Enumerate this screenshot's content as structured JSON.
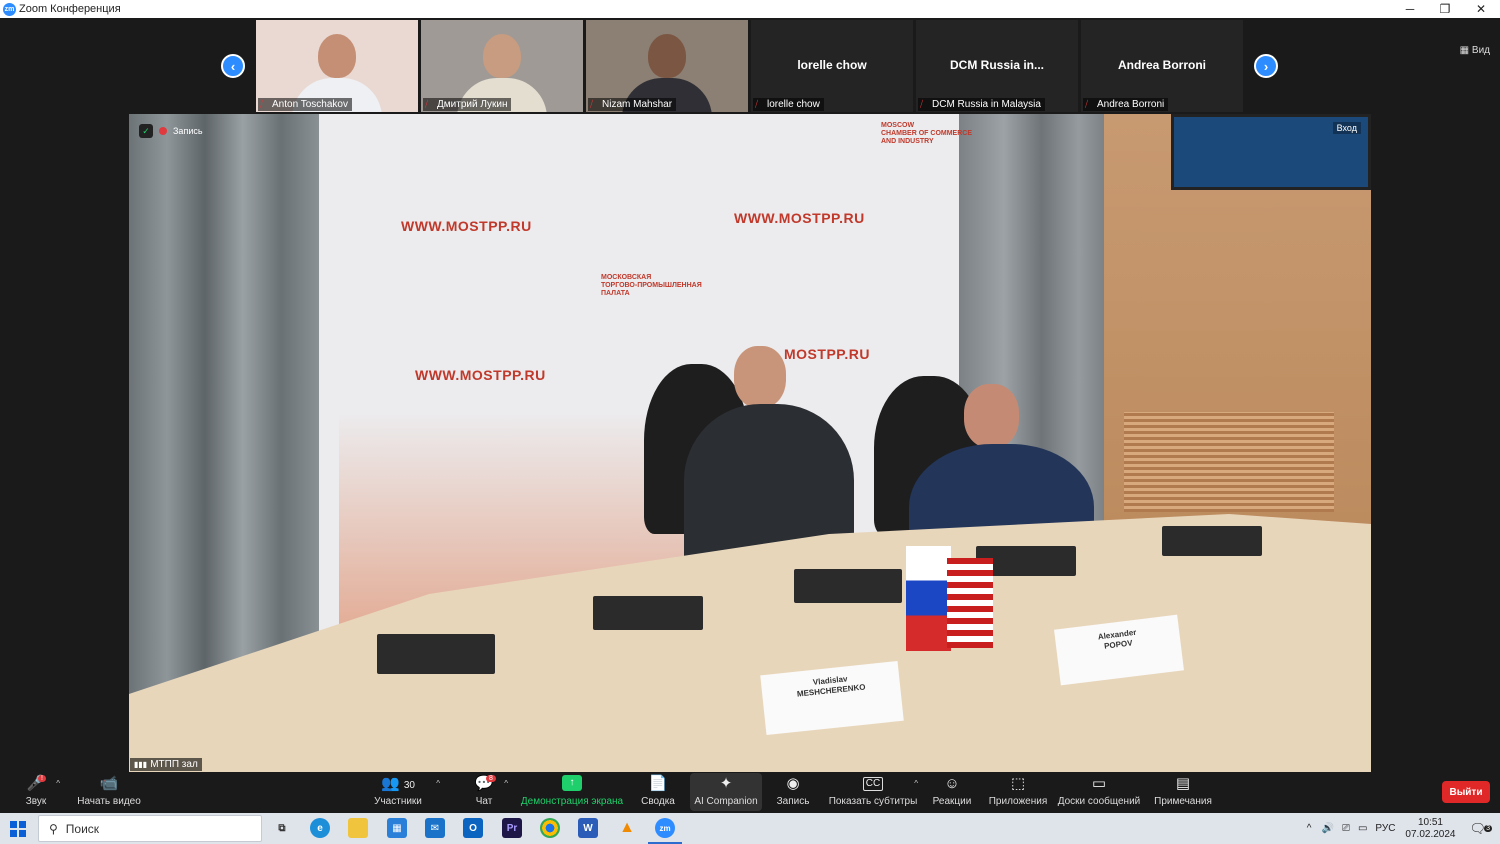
{
  "window": {
    "title": "Zoom Конференция",
    "controls": [
      "─",
      "❐",
      "✕"
    ]
  },
  "view_button": "Вид",
  "participants_strip": [
    {
      "name": "Anton Toschakov",
      "has_video": true,
      "bg": "#e9d9d2",
      "skin": "#c48f75",
      "shirt": "#eef0f4"
    },
    {
      "name": "Дмитрий Лукин",
      "has_video": true,
      "bg": "#9f9a96",
      "skin": "#c79c80",
      "shirt": "#e4ded1"
    },
    {
      "name": "Nizam Mahshar",
      "has_video": true,
      "bg": "#8c7f73",
      "skin": "#7a5643",
      "shirt": "#2f2f35"
    },
    {
      "name": "lorelle chow",
      "has_video": false,
      "display": "lorelle chow"
    },
    {
      "name": "DCM Russia in Malaysia",
      "has_video": false,
      "display": "DCM Russia in..."
    },
    {
      "name": "Andrea Borroni",
      "has_video": false,
      "display": "Andrea Borroni"
    }
  ],
  "video": {
    "recording_label": "Запись",
    "enter_label": "Вход",
    "speaker_name": "МТПП зал",
    "backdrop_text": [
      "WWW.MOSTPP.RU",
      "WWW.MOSTPP.RU",
      "WWW.MOSTPP.RU",
      "MOSTPP.RU"
    ],
    "backdrop_org": [
      "МОСКОВСКАЯ",
      "ТОРГОВО-ПРОМЫШЛЕННАЯ",
      "ПАЛАТА"
    ],
    "backdrop_org_en": [
      "MOSCOW",
      "CHAMBER OF COMMERCE",
      "AND INDUSTRY"
    ],
    "nameplates": [
      {
        "line1": "Vladislav",
        "line2": "MESHCHERENKO"
      },
      {
        "line1": "Alexander",
        "line2": "POPOV"
      }
    ]
  },
  "toolbar": {
    "audio": "Звук",
    "video": "Начать видео",
    "participants": "Участники",
    "participants_count": "30",
    "chat": "Чат",
    "chat_badge": "8",
    "share": "Демонстрация экрана",
    "summary": "Сводка",
    "companion": "AI Companion",
    "record": "Запись",
    "captions": "Показать субтитры",
    "reactions": "Реакции",
    "apps": "Приложения",
    "whiteboards": "Доски сообщений",
    "notes": "Примечания",
    "leave": "Выйти",
    "share_color": "#1fcf6b"
  },
  "taskbar": {
    "search_placeholder": "Поиск",
    "apps": [
      "task-view",
      "edge",
      "explorer",
      "store",
      "mail",
      "outlook",
      "premiere",
      "chrome",
      "word",
      "vlc",
      "zoom"
    ],
    "tray_lang": "РУС",
    "time": "10:51",
    "date": "07.02.2024",
    "notif_count": "3"
  }
}
